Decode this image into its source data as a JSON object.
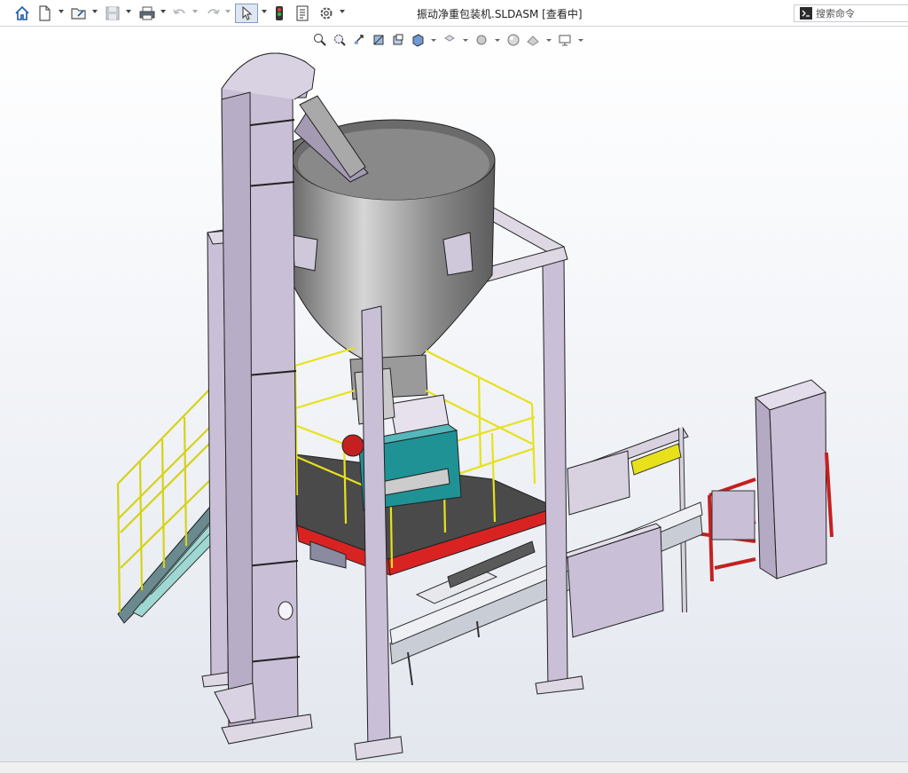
{
  "window": {
    "title": "振动净重包装机.SLDASM [查看中]"
  },
  "toolbar": {
    "items": [
      {
        "name": "home-icon"
      },
      {
        "name": "new-document-icon"
      },
      {
        "name": "open-folder-icon"
      },
      {
        "name": "save-icon"
      },
      {
        "name": "print-icon"
      },
      {
        "name": "undo-icon"
      },
      {
        "name": "redo-icon"
      },
      {
        "name": "select-cursor-icon"
      },
      {
        "name": "rebuild-traffic-light-icon"
      },
      {
        "name": "file-properties-icon"
      },
      {
        "name": "options-gear-icon"
      }
    ]
  },
  "search": {
    "placeholder": "搜索命令"
  },
  "heads_up_toolbar": {
    "items": [
      {
        "name": "zoom-to-fit-icon"
      },
      {
        "name": "zoom-to-area-icon"
      },
      {
        "name": "previous-view-icon"
      },
      {
        "name": "section-view-icon"
      },
      {
        "name": "dynamic-annotation-icon"
      },
      {
        "name": "view-orientation-icon"
      },
      {
        "name": "display-style-icon"
      },
      {
        "name": "hide-show-items-icon"
      },
      {
        "name": "edit-appearance-icon"
      },
      {
        "name": "apply-scene-icon"
      },
      {
        "name": "view-settings-icon"
      }
    ]
  },
  "colors": {
    "frame": "#c9bfd6",
    "frame_edge": "#2a2a2a",
    "hopper": "#8c8c8c",
    "railing": "#e8e41a",
    "platform": "#4a4a4a",
    "red_beam": "#d91e1e",
    "teal": "#1b8f91",
    "dark_red": "#9b1b1b"
  }
}
